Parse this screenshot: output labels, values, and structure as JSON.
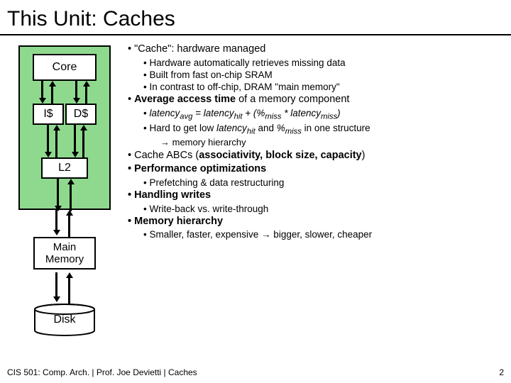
{
  "title": "This Unit: Caches",
  "diagram": {
    "core": "Core",
    "icache": "I$",
    "dcache": "D$",
    "l2": "L2",
    "mainmem_line1": "Main",
    "mainmem_line2": "Memory",
    "disk": "Disk"
  },
  "bullets": {
    "b1": "\"Cache\": hardware managed",
    "b1a": "Hardware automatically retrieves missing data",
    "b1b": "Built from fast on-chip SRAM",
    "b1c": "In contrast to off-chip, DRAM \"main memory\"",
    "b2_pre": "Average access time",
    "b2_post": " of a memory component",
    "b2a_pre": "latency",
    "b2a_avg": "avg",
    "b2a_eq": " = latency",
    "b2a_hit": "hit",
    "b2a_plus": " + (%",
    "b2a_miss": "miss",
    "b2a_times": " * latency",
    "b2a_miss2": "miss",
    "b2a_close": ")",
    "b2b_pre": "Hard to get low ",
    "b2b_lh": "latency",
    "b2b_hit": "hit",
    "b2b_and": " and ",
    "b2b_pm": "%",
    "b2b_miss": "miss",
    "b2b_post": " in one structure",
    "b2b_arrow": "→ memory hierarchy",
    "b3_pre": "Cache ABCs (",
    "b3_bold": "associativity, block size, capacity",
    "b3_post": ")",
    "b4": "Performance optimizations",
    "b4a": "Prefetching & data restructuring",
    "b5": "Handling writes",
    "b5a": "Write-back vs. write-through",
    "b6": "Memory hierarchy",
    "b6a": "Smaller, faster, expensive → bigger, slower, cheaper"
  },
  "footer": {
    "left": "CIS 501: Comp. Arch. | Prof. Joe Devietti | Caches",
    "page": "2"
  }
}
